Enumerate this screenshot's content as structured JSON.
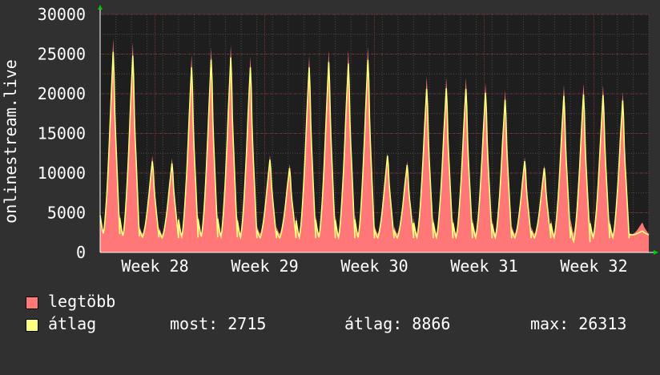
{
  "chart_data": {
    "type": "area",
    "ylabel": "onlinestream.live",
    "ylim": [
      0,
      30000
    ],
    "yticks": [
      0,
      5000,
      10000,
      15000,
      20000,
      25000,
      30000
    ],
    "ytick_labels": [
      "0",
      "5000",
      "10000",
      "15000",
      "20000",
      "25000",
      "30000"
    ],
    "xticks": [
      "Week 28",
      "Week 29",
      "Week 30",
      "Week 31",
      "Week 32"
    ],
    "xlim_days": [
      0,
      35
    ],
    "grid": true,
    "series": [
      {
        "name": "legtöbb",
        "color": "#ff7777",
        "daily_peaks": [
          27700,
          27200,
          12500,
          12200,
          25600,
          26600,
          26900,
          25400,
          12600,
          11400,
          25500,
          26200,
          26200,
          26700,
          12900,
          11800,
          22800,
          22700,
          22600,
          22000,
          21000,
          12300,
          11300,
          21700,
          21900,
          21700,
          20800,
          3800
        ],
        "daily_troughs": [
          2600,
          2400,
          2300,
          2200,
          2300,
          2300,
          2300,
          2300,
          2300,
          2300,
          2300,
          2300,
          2300,
          2300,
          2300,
          2300,
          2300,
          2300,
          2300,
          2300,
          2300,
          2300,
          2300,
          2300,
          2300,
          2300,
          2300,
          2300
        ]
      },
      {
        "name": "átlag",
        "color": "#ffff80",
        "daily_peaks": [
          26000,
          25500,
          11800,
          11500,
          24000,
          25000,
          25300,
          24000,
          12000,
          10900,
          24000,
          24700,
          24500,
          25000,
          12500,
          11300,
          21200,
          21300,
          21200,
          20700,
          19800,
          11800,
          10900,
          20300,
          20500,
          20400,
          19700,
          2700
        ],
        "daily_troughs": [
          2300,
          2000,
          1900,
          1800,
          1900,
          1900,
          1900,
          1800,
          1800,
          1800,
          1800,
          1800,
          1800,
          1800,
          1800,
          1800,
          1800,
          1800,
          1800,
          1800,
          1800,
          1800,
          1800,
          1800,
          1300,
          1800,
          1800,
          2200
        ]
      }
    ]
  },
  "legend": [
    {
      "label": "legtöbb",
      "color": "#ff7777"
    },
    {
      "label": "átlag",
      "color": "#ffff80"
    }
  ],
  "stats": {
    "most": "most: 2715",
    "atlag": "átlag: 8866",
    "max": "max: 26313"
  },
  "colors": {
    "background": "#303030",
    "plot_bg": "#1e1e1e",
    "grid": "#4a4a4a",
    "major_grid": "#7a3030",
    "axis_arrow": "#00cc00",
    "text": "#ffffff"
  }
}
